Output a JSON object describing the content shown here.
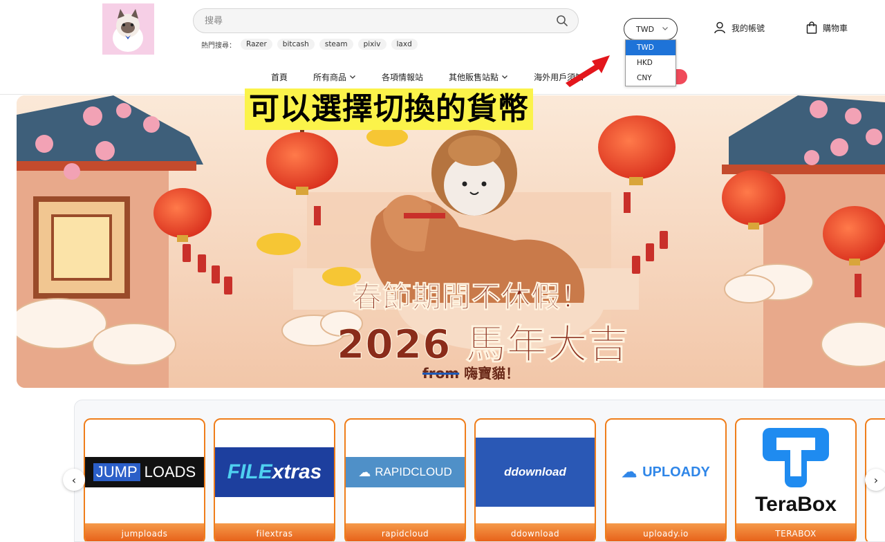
{
  "search": {
    "placeholder": "搜尋"
  },
  "hot_search": {
    "label": "熱門搜尋：",
    "tags": [
      "Razer",
      "bitcash",
      "steam",
      "pixiv",
      "laxd"
    ]
  },
  "currency": {
    "selected": "TWD",
    "options": [
      "TWD",
      "HKD",
      "CNY"
    ]
  },
  "account": {
    "label": "我的帳號"
  },
  "cart": {
    "label": "購物車"
  },
  "nav": {
    "items": [
      "首頁",
      "所有商品",
      "各項情報站",
      "其他販售站點",
      "海外用戶須知"
    ]
  },
  "annotation": {
    "text": "可以選擇切換的貨幣"
  },
  "banner": {
    "line1": "春節期間不休假！",
    "line2": "2026 馬年大吉",
    "from": "from",
    "brand": "嗨寶貓！"
  },
  "products": {
    "prev_symbol": "‹",
    "next_symbol": "›",
    "items": [
      {
        "name": "jumploads",
        "logo_a": "JUMP",
        "logo_b": "LOADS"
      },
      {
        "name": "filextras",
        "logo_a": "FILE",
        "logo_b": "xtras"
      },
      {
        "name": "rapidcloud",
        "logo_a": "RAPIDCLOUD"
      },
      {
        "name": "ddownload",
        "logo_a": "ddownload"
      },
      {
        "name": "uploady.io",
        "logo_a": "UPLOADY"
      },
      {
        "name": "TERABOX",
        "logo_a": "TeraBox"
      }
    ]
  },
  "colors": {
    "accent": "#ef7d1a",
    "dropdown_selected": "#1e73d8",
    "annotation_bg": "#fbf34a",
    "banner_text": "#8a2c1a"
  }
}
